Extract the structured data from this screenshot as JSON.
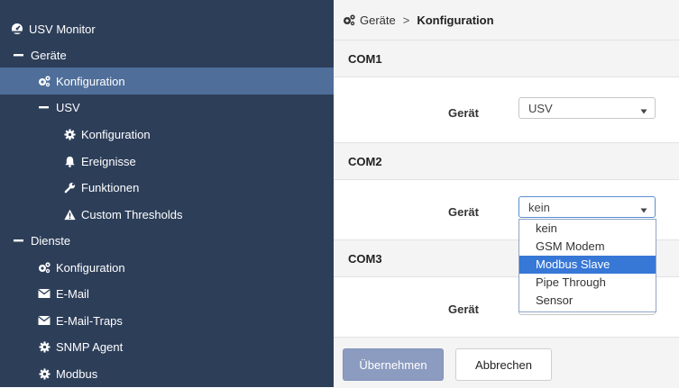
{
  "sidebar": {
    "title": "USV Monitor",
    "items": [
      {
        "label": "Geräte",
        "icon": "minus-icon",
        "active": false
      },
      {
        "label": "Konfiguration",
        "icon": "cogs-icon",
        "active": true
      },
      {
        "label": "USV",
        "icon": "minus-icon",
        "active": false
      },
      {
        "label": "Konfiguration",
        "icon": "gear-icon",
        "active": false
      },
      {
        "label": "Ereignisse",
        "icon": "bell-icon",
        "active": false
      },
      {
        "label": "Funktionen",
        "icon": "wrench-icon",
        "active": false
      },
      {
        "label": "Custom Thresholds",
        "icon": "warning-icon",
        "active": false
      },
      {
        "label": "Dienste",
        "icon": "minus-icon",
        "active": false
      },
      {
        "label": "Konfiguration",
        "icon": "cogs-icon",
        "active": false
      },
      {
        "label": "E-Mail",
        "icon": "envelope-icon",
        "active": false
      },
      {
        "label": "E-Mail-Traps",
        "icon": "envelope-icon",
        "active": false
      },
      {
        "label": "SNMP Agent",
        "icon": "gear-icon",
        "active": false
      },
      {
        "label": "Modbus",
        "icon": "gear-icon",
        "active": false
      }
    ]
  },
  "breadcrumb": {
    "parent": "Geräte",
    "separator": ">",
    "current": "Konfiguration"
  },
  "sections": [
    {
      "title": "COM1",
      "field_label": "Gerät",
      "value": "USV"
    },
    {
      "title": "COM2",
      "field_label": "Gerät",
      "value": "kein"
    },
    {
      "title": "COM3",
      "field_label": "Gerät",
      "value": ""
    }
  ],
  "dropdown": {
    "options": [
      "kein",
      "GSM Modem",
      "Modbus Slave",
      "Pipe Through",
      "Sensor"
    ],
    "highlighted": "Modbus Slave"
  },
  "buttons": {
    "apply": "Übernehmen",
    "cancel": "Abbrechen"
  },
  "colors": {
    "sidebar_bg": "#2d3e59",
    "active_bg": "#4f6e99",
    "highlight": "#3777d6",
    "primary_button": "#8c9cc0"
  }
}
